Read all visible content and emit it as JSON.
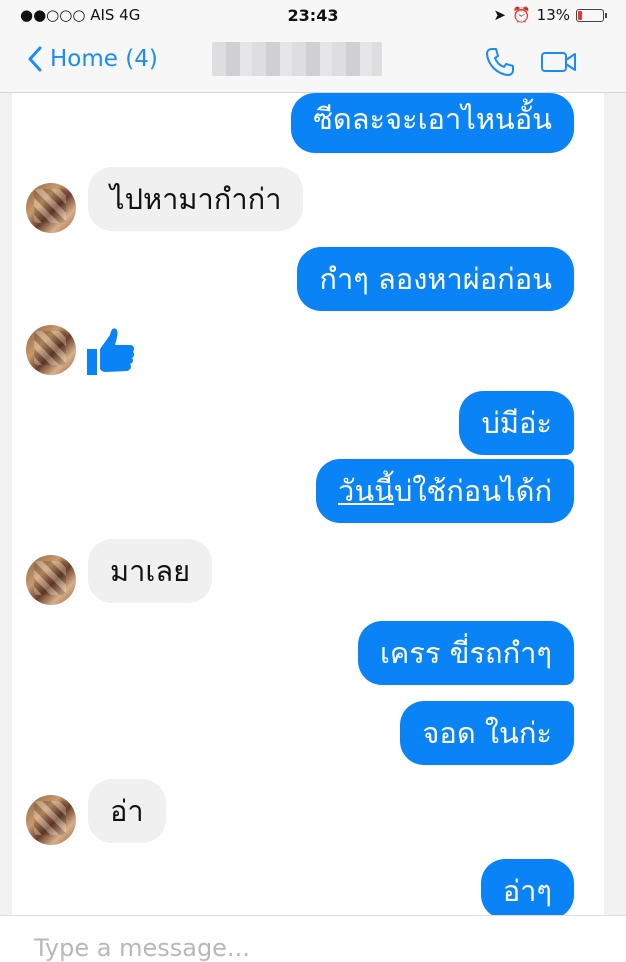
{
  "status_bar": {
    "carrier": "●●○○○ AIS  4G",
    "time": "23:43",
    "battery": "13%"
  },
  "nav": {
    "back_label": "Home (4)",
    "call_icon": "phone-icon",
    "video_icon": "video-camera-icon"
  },
  "messages": [
    {
      "dir": "out",
      "text": "ซีดละจะเอาไหนอั้น"
    },
    {
      "dir": "in",
      "text": "ไปหามากำก่า"
    },
    {
      "dir": "out",
      "text": "กำๆ ลองหาผ่อก่อน"
    },
    {
      "dir": "in",
      "type": "thumbs-up"
    },
    {
      "dir": "out",
      "text": "บ่มีอ่ะ"
    },
    {
      "dir": "out",
      "text_underlined": "วันนี้",
      "text_rest": "บ่ใช้ก่อนได้ก่"
    },
    {
      "dir": "in",
      "text": "มาเลย"
    },
    {
      "dir": "out",
      "text": "เครร ขี่รถกำๆ"
    },
    {
      "dir": "out",
      "text": "จอด ในก่ะ"
    },
    {
      "dir": "in",
      "text": "อ่า"
    },
    {
      "dir": "out",
      "text": "อ่าๆ"
    }
  ],
  "composer": {
    "placeholder": "Type a message..."
  },
  "colors": {
    "accent": "#0a83f7",
    "incoming_bubble": "#f0f0f1"
  }
}
